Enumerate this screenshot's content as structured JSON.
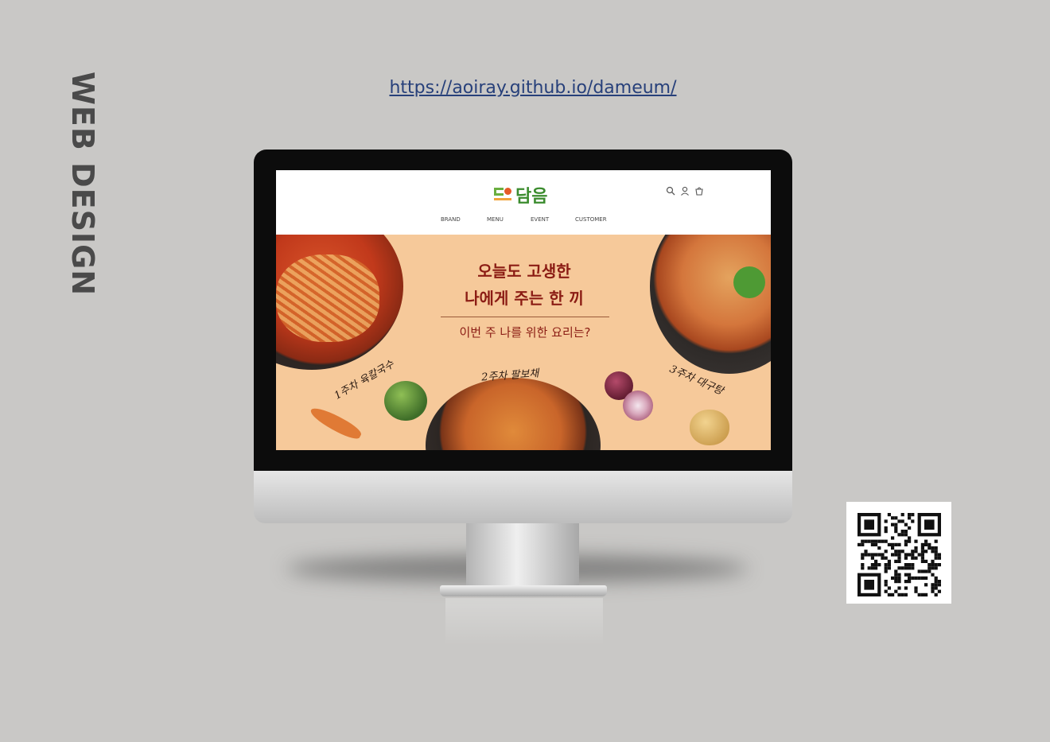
{
  "side_title": "WEB DESIGN",
  "site_url": "https://aoiray.github.io/dameum/",
  "site": {
    "logo_text": "담음",
    "icons": [
      "search-icon",
      "user-icon",
      "cart-icon"
    ],
    "nav": [
      "BRAND",
      "MENU",
      "EVENT",
      "CUSTOMER"
    ]
  },
  "banner": {
    "headline_line1": "오늘도 고생한",
    "headline_line2": "나에게 주는 한 끼",
    "subheadline": "이번 주 나를 위한 요리는?",
    "week1": "1주차 육칼국수",
    "week2": "2주차 팔보채",
    "week3": "3주차 대구탕"
  },
  "colors": {
    "page_bg": "#c9c8c6",
    "banner_bg": "#f6c99a",
    "headline": "#8b1c14",
    "logo_green": "#3b8c2e",
    "url_blue": "#27407a"
  }
}
